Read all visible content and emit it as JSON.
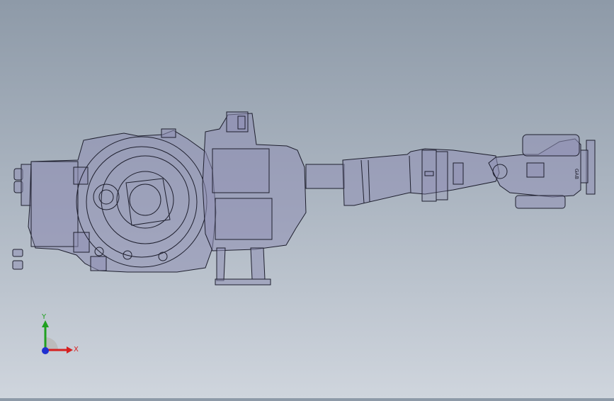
{
  "viewport": {
    "background_top": "#8e9aa8",
    "background_bottom": "#cfd5dd",
    "model_fill": "#8f90b4",
    "model_stroke": "#1e1f2e"
  },
  "triad": {
    "x_label": "X",
    "y_label": "Y",
    "x_color": "#d62020",
    "y_color": "#20a020",
    "z_color": "#2030d0"
  },
  "model": {
    "wrist_marking": "GAB"
  }
}
